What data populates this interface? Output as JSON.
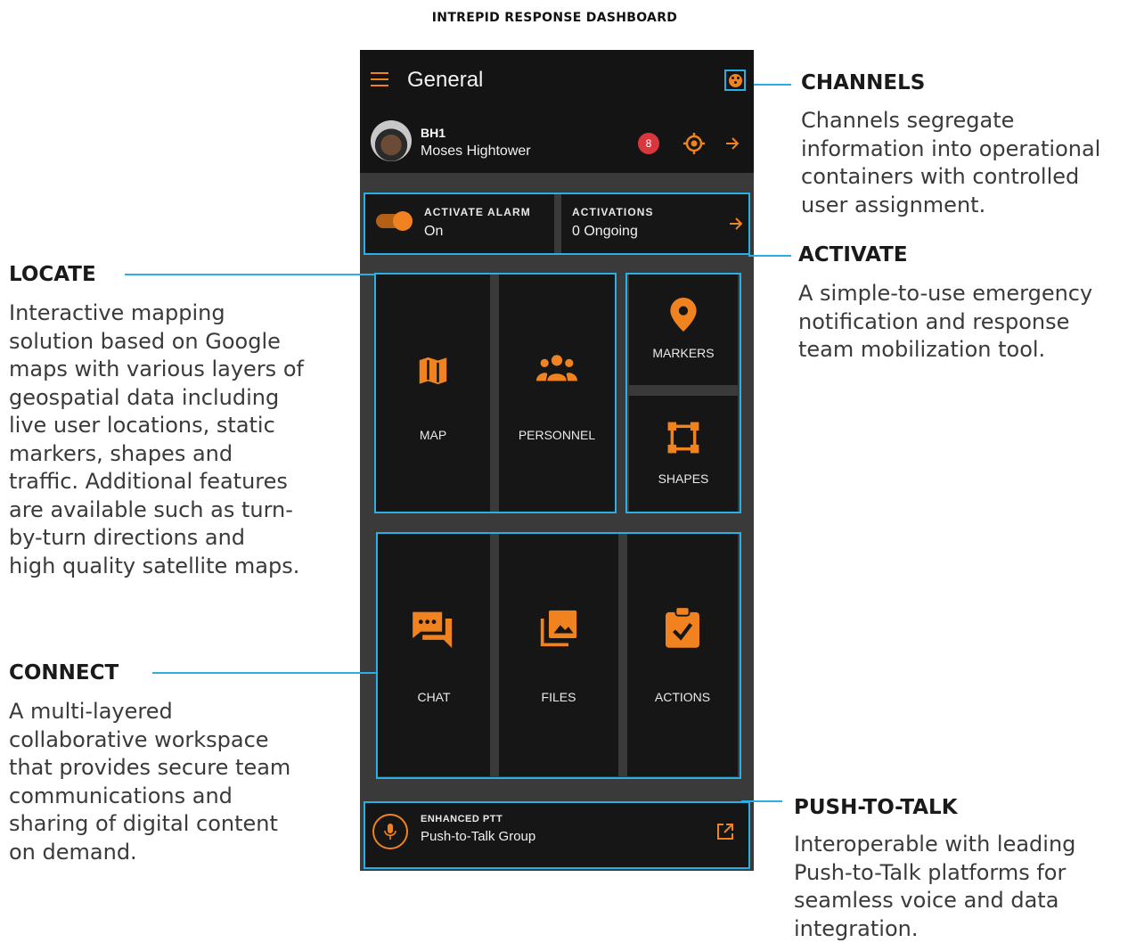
{
  "page": {
    "title": "INTREPID RESPONSE DASHBOARD"
  },
  "app": {
    "title": "General",
    "user": {
      "id": "BH1",
      "name": "Moses Hightower"
    },
    "badge_text": "8",
    "alarm": {
      "label": "ACTIVATE ALARM",
      "value": "On"
    },
    "activations": {
      "label": "ACTIVATIONS",
      "value": "0 Ongoing"
    },
    "tiles": {
      "map": "MAP",
      "personnel": "PERSONNEL",
      "markers": "MARKERS",
      "shapes": "SHAPES",
      "chat": "CHAT",
      "files": "FILES",
      "actions": "ACTIONS"
    },
    "ptt": {
      "label": "ENHANCED PTT",
      "group": "Push-to-Talk Group"
    }
  },
  "callouts": {
    "channels": {
      "title": "CHANNELS",
      "lines": [
        "Channels segregate",
        "information into operational",
        "containers with controlled",
        "user assignment."
      ]
    },
    "activate": {
      "title": "ACTIVATE",
      "lines": [
        "A simple-to-use emergency",
        "notification and response",
        "team mobilization tool."
      ]
    },
    "locate": {
      "title": "LOCATE",
      "lines": [
        "Interactive mapping",
        "solution based on Google",
        "maps with various layers of",
        "geospatial data including",
        "live user locations, static",
        "markers, shapes and",
        "traffic. Additional features",
        "are available such as turn-",
        "by-turn directions and",
        "high quality satellite maps."
      ]
    },
    "connect": {
      "title": "CONNECT",
      "lines": [
        "A multi-layered",
        "collaborative workspace",
        "that provides secure team",
        "communications and",
        "sharing of digital content",
        "on demand."
      ]
    },
    "ptt": {
      "title": "PUSH-TO-TALK",
      "lines": [
        "Interoperable with leading",
        "Push-to-Talk platforms for",
        "seamless voice and data",
        "integration."
      ]
    }
  },
  "colors": {
    "accent": "#f0821f",
    "highlight": "#29aee6",
    "tile_bg": "#161616",
    "gutter": "#3a3a3a"
  },
  "icons": [
    "menu-icon",
    "channel-icon",
    "badge-icon",
    "target-icon",
    "arrow-right-icon",
    "toggle-icon",
    "map-icon",
    "people-icon",
    "marker-pin-icon",
    "shape-square-icon",
    "chat-icon",
    "files-icon",
    "clipboard-check-icon",
    "mic-icon",
    "external-link-icon"
  ]
}
